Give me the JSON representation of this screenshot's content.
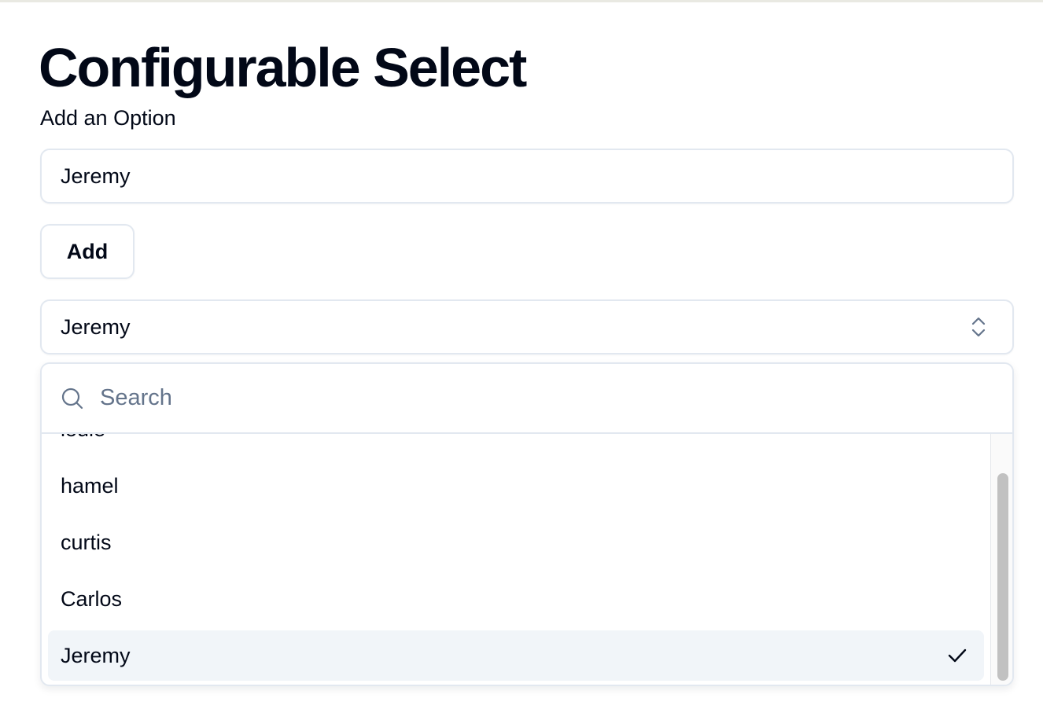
{
  "page": {
    "title": "Configurable Select",
    "add_label": "Add an Option"
  },
  "add_form": {
    "input_value": "Jeremy",
    "button_label": "Add"
  },
  "select": {
    "selected_value": "Jeremy",
    "search_placeholder": "Search",
    "options": [
      {
        "label": "louie",
        "selected": false
      },
      {
        "label": "hamel",
        "selected": false
      },
      {
        "label": "curtis",
        "selected": false
      },
      {
        "label": "Carlos",
        "selected": false
      },
      {
        "label": "Jeremy",
        "selected": true
      }
    ],
    "icons": {
      "trigger": "chevrons-up-down-icon",
      "search": "search-icon",
      "selected": "check-icon"
    }
  },
  "colors": {
    "text": "#020817",
    "border": "#e2e8f0",
    "selected_bg": "#f1f5f9",
    "placeholder": "#64748b"
  }
}
